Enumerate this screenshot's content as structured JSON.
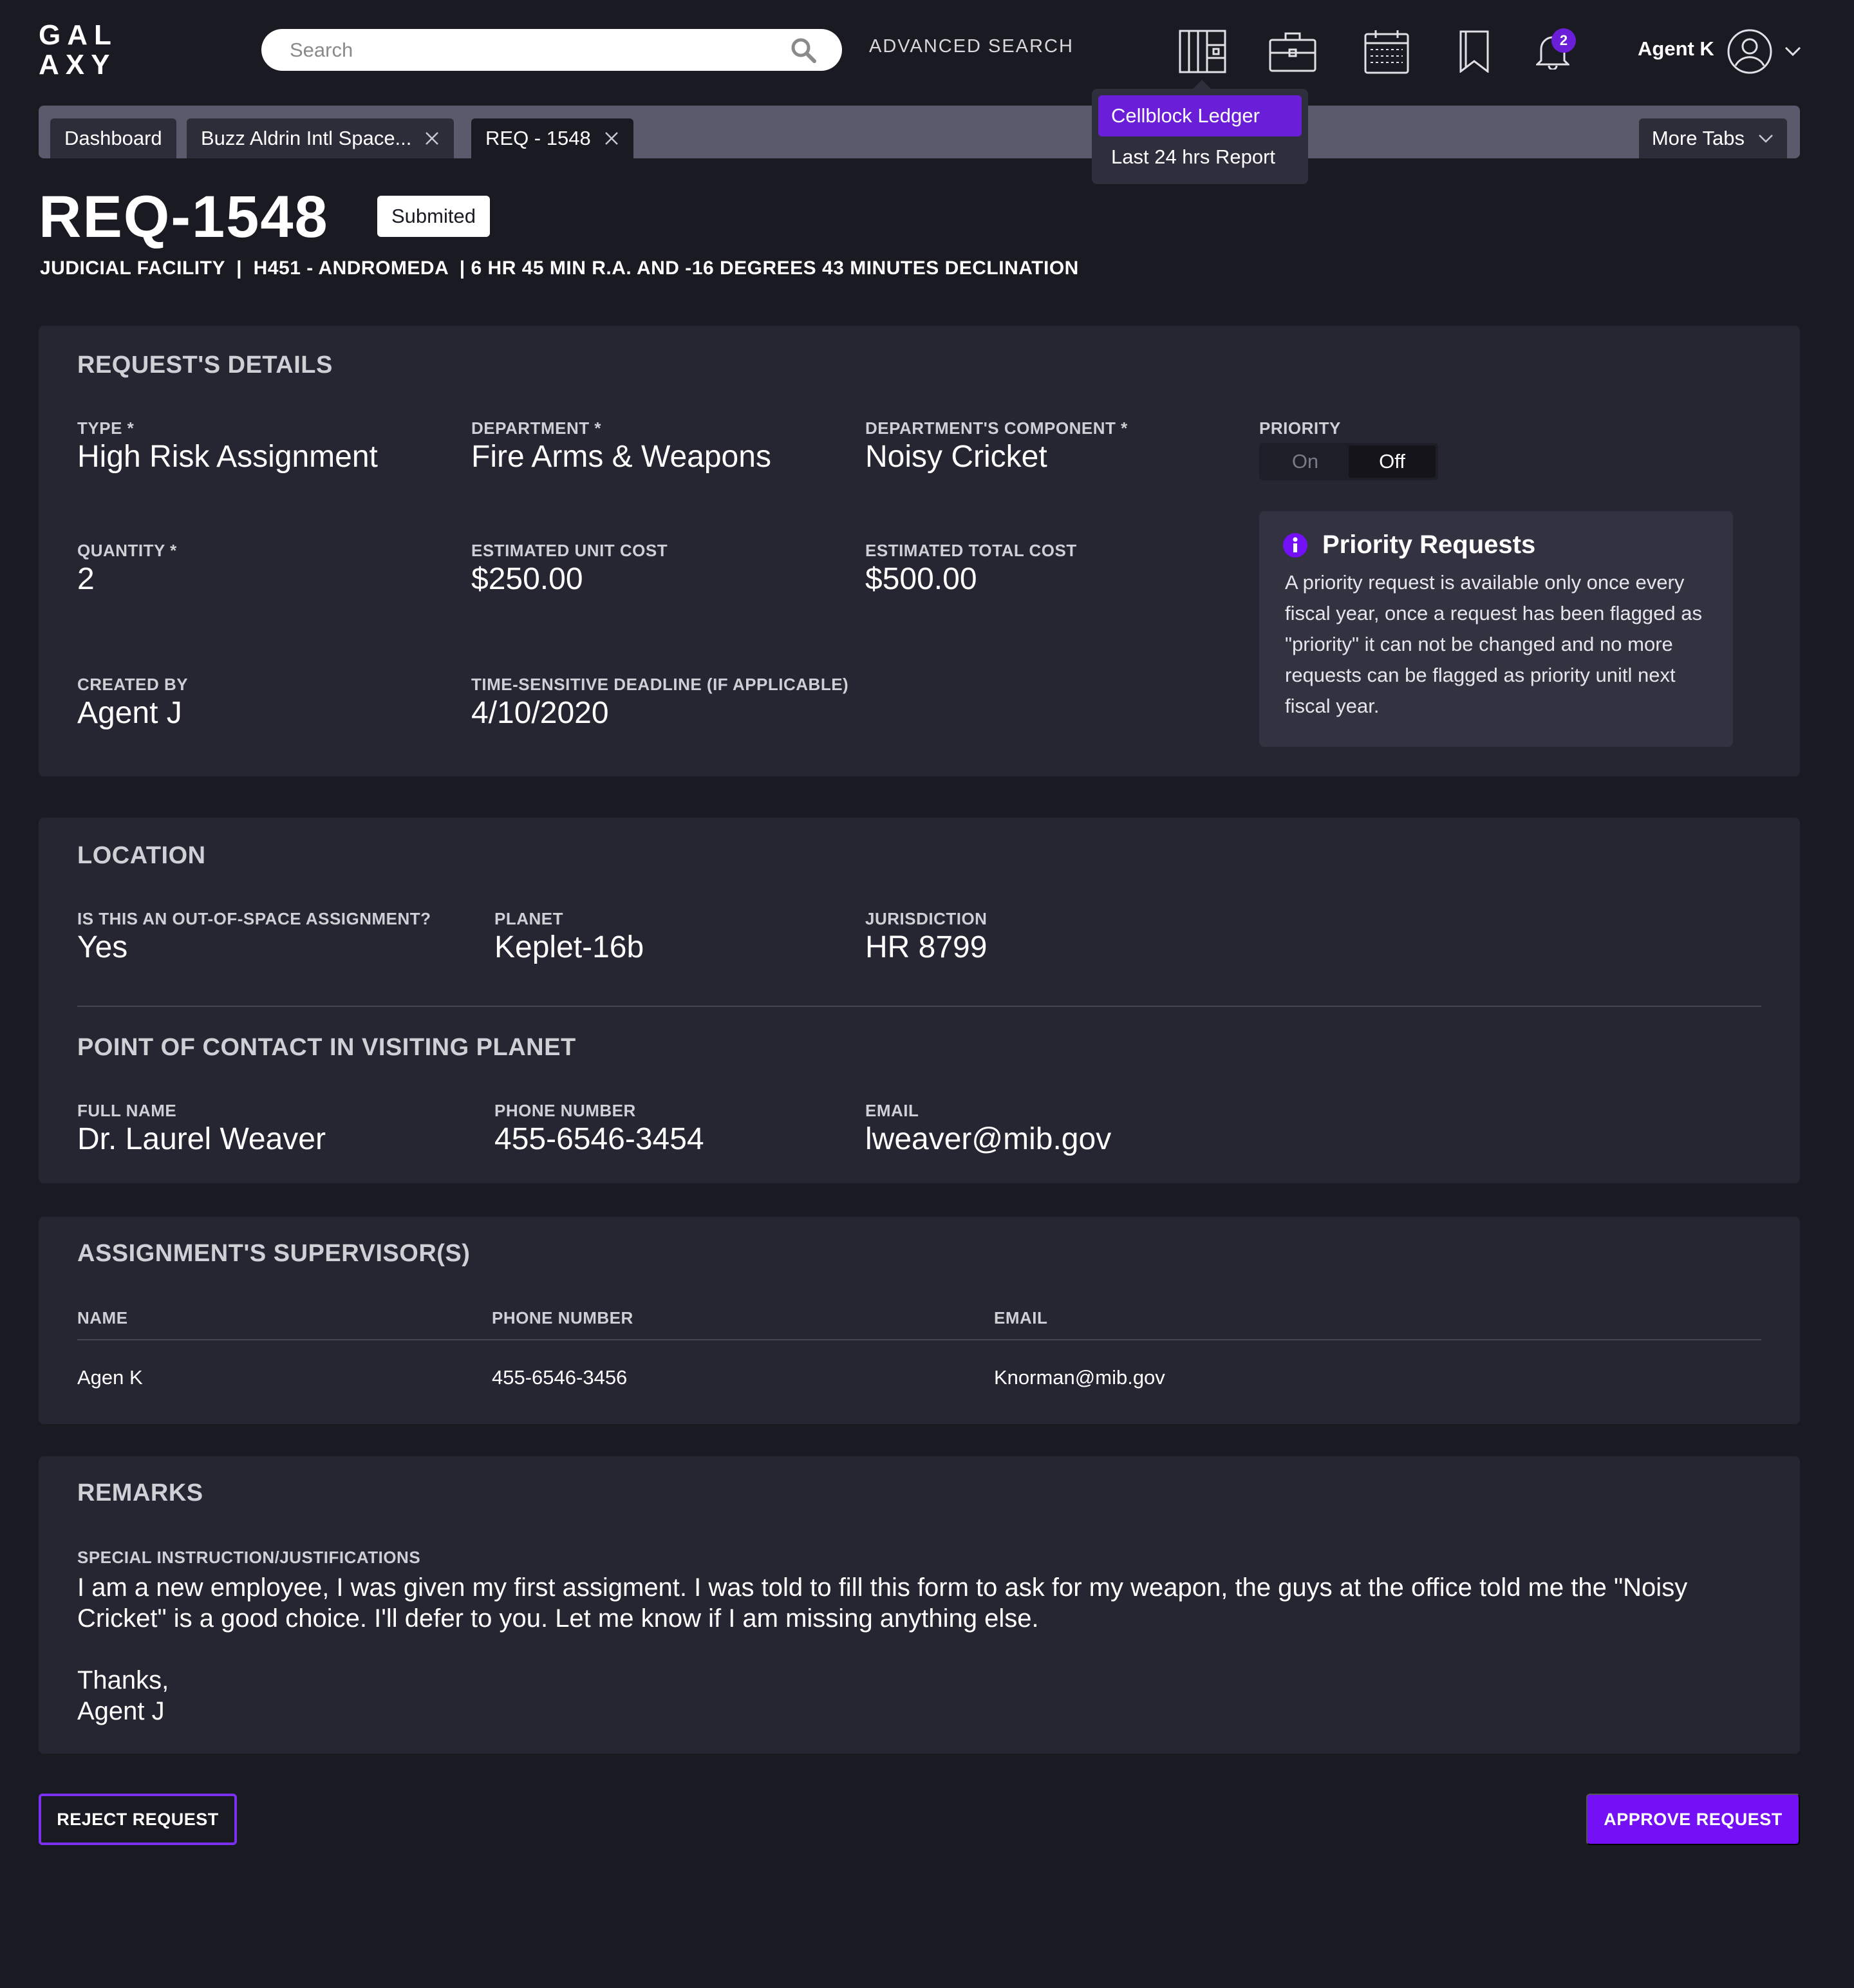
{
  "header": {
    "logo_line1": "GAL",
    "logo_line2": "AXY",
    "search_placeholder": "Search",
    "advanced_search": "ADVANCED SEARCH",
    "notification_count": "2",
    "user_name": "Agent K",
    "icons": [
      "ledger-icon",
      "briefcase-icon",
      "calendar-icon",
      "bookmark-icon",
      "bell-icon",
      "user-avatar-icon"
    ]
  },
  "dropdown": {
    "items": [
      "Cellblock Ledger",
      "Last 24 hrs Report"
    ]
  },
  "tabs": {
    "items": [
      "Dashboard",
      "Buzz Aldrin Intl Space...",
      "REQ - 1548"
    ],
    "more": "More Tabs"
  },
  "request": {
    "title": "REQ-1548",
    "status": "Submited",
    "subtitle": "JUDICIAL FACILITY  |  H451 - ANDROMEDA  | 6 HR 45 MIN R.A. AND -16 DEGREES 43 MINUTES DECLINATION"
  },
  "details": {
    "title": "REQUEST'S DETAILS",
    "type_label": "TYPE *",
    "type_value": "High Risk Assignment",
    "department_label": "DEPARTMENT *",
    "department_value": "Fire Arms & Weapons",
    "component_label": "DEPARTMENT'S COMPONENT *",
    "component_value": "Noisy Cricket",
    "priority_label": "PRIORITY",
    "priority_on": "On",
    "priority_off": "Off",
    "quantity_label": "QUANTITY *",
    "quantity_value": "2",
    "unit_cost_label": "ESTIMATED UNIT COST",
    "unit_cost_value": "$250.00",
    "total_cost_label": "ESTIMATED TOTAL COST",
    "total_cost_value": "$500.00",
    "created_by_label": "CREATED BY",
    "created_by_value": "Agent J",
    "deadline_label": "TIME-SENSITIVE DEADLINE (IF APPLICABLE)",
    "deadline_value": "4/10/2020",
    "info_title": "Priority Requests",
    "info_body": "A priority request is available only once every fiscal year, once a request has been flagged as \"priority\" it can not be changed and no more requests can be flagged as priority unitl next fiscal year."
  },
  "location": {
    "title": "LOCATION",
    "out_of_space_label": "IS THIS AN OUT-OF-SPACE ASSIGNMENT?",
    "out_of_space_value": "Yes",
    "planet_label": "PLANET",
    "planet_value": "Keplet-16b",
    "jurisdiction_label": "JURISDICTION",
    "jurisdiction_value": "HR 8799",
    "poc_title": "POINT OF CONTACT IN VISITING PLANET",
    "poc_name_label": "FULL NAME",
    "poc_name_value": "Dr. Laurel Weaver",
    "poc_phone_label": "PHONE NUMBER",
    "poc_phone_value": "455-6546-3454",
    "poc_email_label": "EMAIL",
    "poc_email_value": "lweaver@mib.gov"
  },
  "supervisors": {
    "title": "ASSIGNMENT'S SUPERVISOR(S)",
    "columns": [
      "NAME",
      "PHONE NUMBER",
      "EMAIL"
    ],
    "rows": [
      [
        "Agen K",
        "455-6546-3456",
        "Knorman@mib.gov"
      ]
    ]
  },
  "remarks": {
    "title": "REMARKS",
    "label": "SPECIAL INSTRUCTION/JUSTIFICATIONS",
    "text": "I am a new employee, I was given my first assigment. I was told to fill this form to ask for my weapon, the guys at the office told me the \"Noisy Cricket\" is a good choice. I'll defer to you. Let me know if I am missing anything else.\n\nThanks,\nAgent J"
  },
  "actions": {
    "reject": "REJECT REQUEST",
    "approve": "APPROVE REQUEST"
  },
  "colors": {
    "background": "#1a1a22",
    "card": "#262633",
    "accent": "#7310f5",
    "tabbar": "#5a5a6c"
  }
}
